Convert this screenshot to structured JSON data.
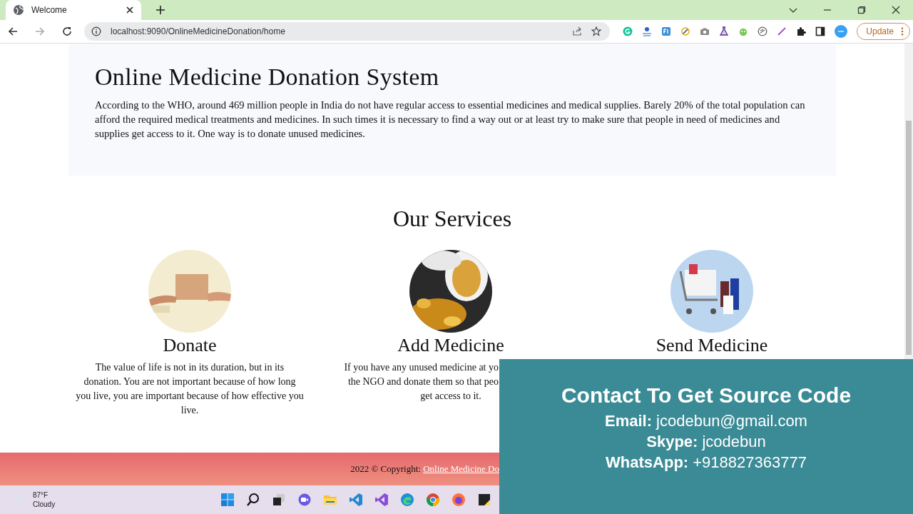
{
  "browser": {
    "tab_title": "Welcome",
    "url": "localhost:9090/OnlineMedicineDonation/home",
    "update_label": "Update"
  },
  "hero": {
    "title": "Online Medicine Donation System",
    "text": "According to the WHO, around 469 million people in India do not have regular access to essential medicines and medical supplies. Barely 20% of the total population can afford the required medical treatments and medicines. In such times it is necessary to find a way out or at least try to make sure that people in need of medicines and supplies get access to it. One way is to donate unused medicines."
  },
  "services": {
    "title": "Our Services",
    "items": [
      {
        "kind": "box",
        "title": "Donate",
        "description": "The value of life is not in its duration, but in its donation. You are not important because of how long you live, you are important because of how effective you live."
      },
      {
        "kind": "pills",
        "title": "Add Medicine",
        "description_lines": [
          {
            "text": "If you have any unused medicine at yo",
            "clipped": true
          },
          {
            "text": "the NGO and donate them so that peo",
            "clipped": true
          },
          {
            "text": "get access to it.",
            "clipped": false
          }
        ]
      },
      {
        "kind": "cart",
        "title": "Send Medicine"
      }
    ]
  },
  "footer": {
    "text": "2022 © Copyright: ",
    "link": "Online Medicine Do"
  },
  "taskbar": {
    "temperature": "87°F",
    "weather": "Cloudy"
  },
  "overlay": {
    "title": "Contact To Get Source Code",
    "lines": [
      {
        "label": "Email:",
        "value": "jcodebun@gmail.com"
      },
      {
        "label": "Skype:",
        "value": "jcodebun"
      },
      {
        "label": "WhatsApp:",
        "value": "+918827363777"
      }
    ]
  }
}
